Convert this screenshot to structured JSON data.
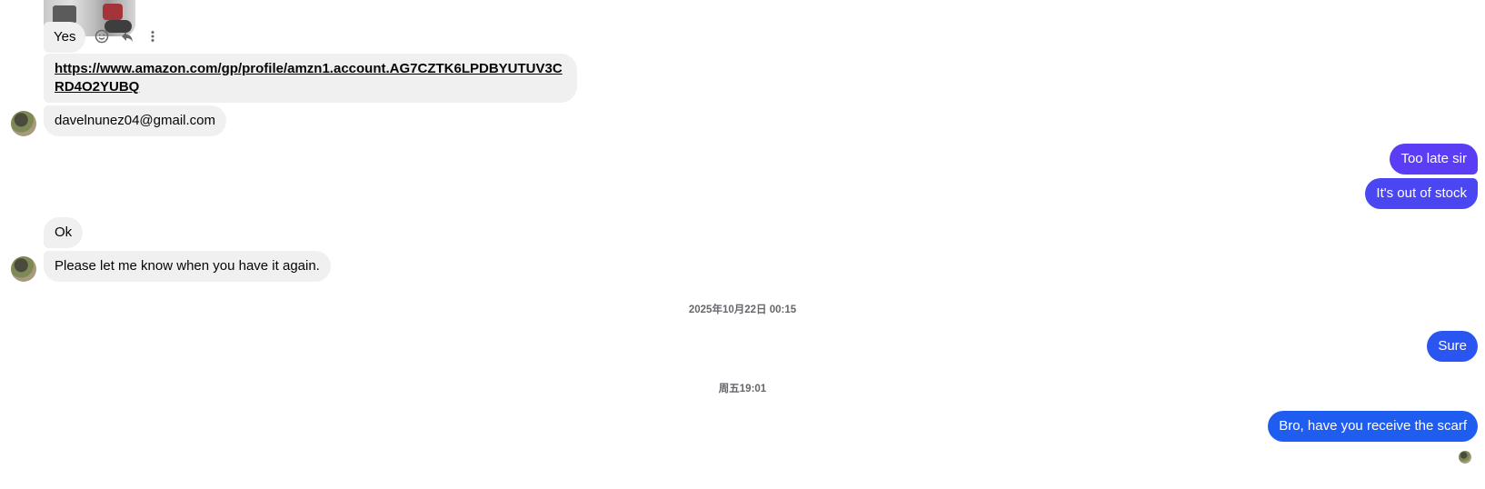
{
  "messages": {
    "yes": "Yes",
    "amazon_link": "https://www.amazon.com/gp/profile/amzn1.account.AG7CZTK6LPDBYUTUV3CRD4O2YUBQ",
    "email": "davelnunez04@gmail.com",
    "too_late": "Too late sir",
    "out_of_stock": "It's out of stock",
    "ok": "Ok",
    "let_me_know": "Please let me know when you have it again.",
    "sure": "Sure",
    "scarf": "Bro, have you receive the scarf"
  },
  "timestamps": {
    "first": "2025年10月22日 00:15",
    "second": "周五19:01"
  },
  "icons": {
    "react": "smiley-icon",
    "reply": "reply-icon",
    "more": "more-vertical-icon"
  },
  "colors": {
    "incoming_bubble": "#f0f0f0",
    "outgoing_purple": "#5b3df5",
    "outgoing_blue_violet": "#4a46f2",
    "outgoing_blue": "#2a55f0",
    "outgoing_deep_blue": "#1f5cf0"
  }
}
